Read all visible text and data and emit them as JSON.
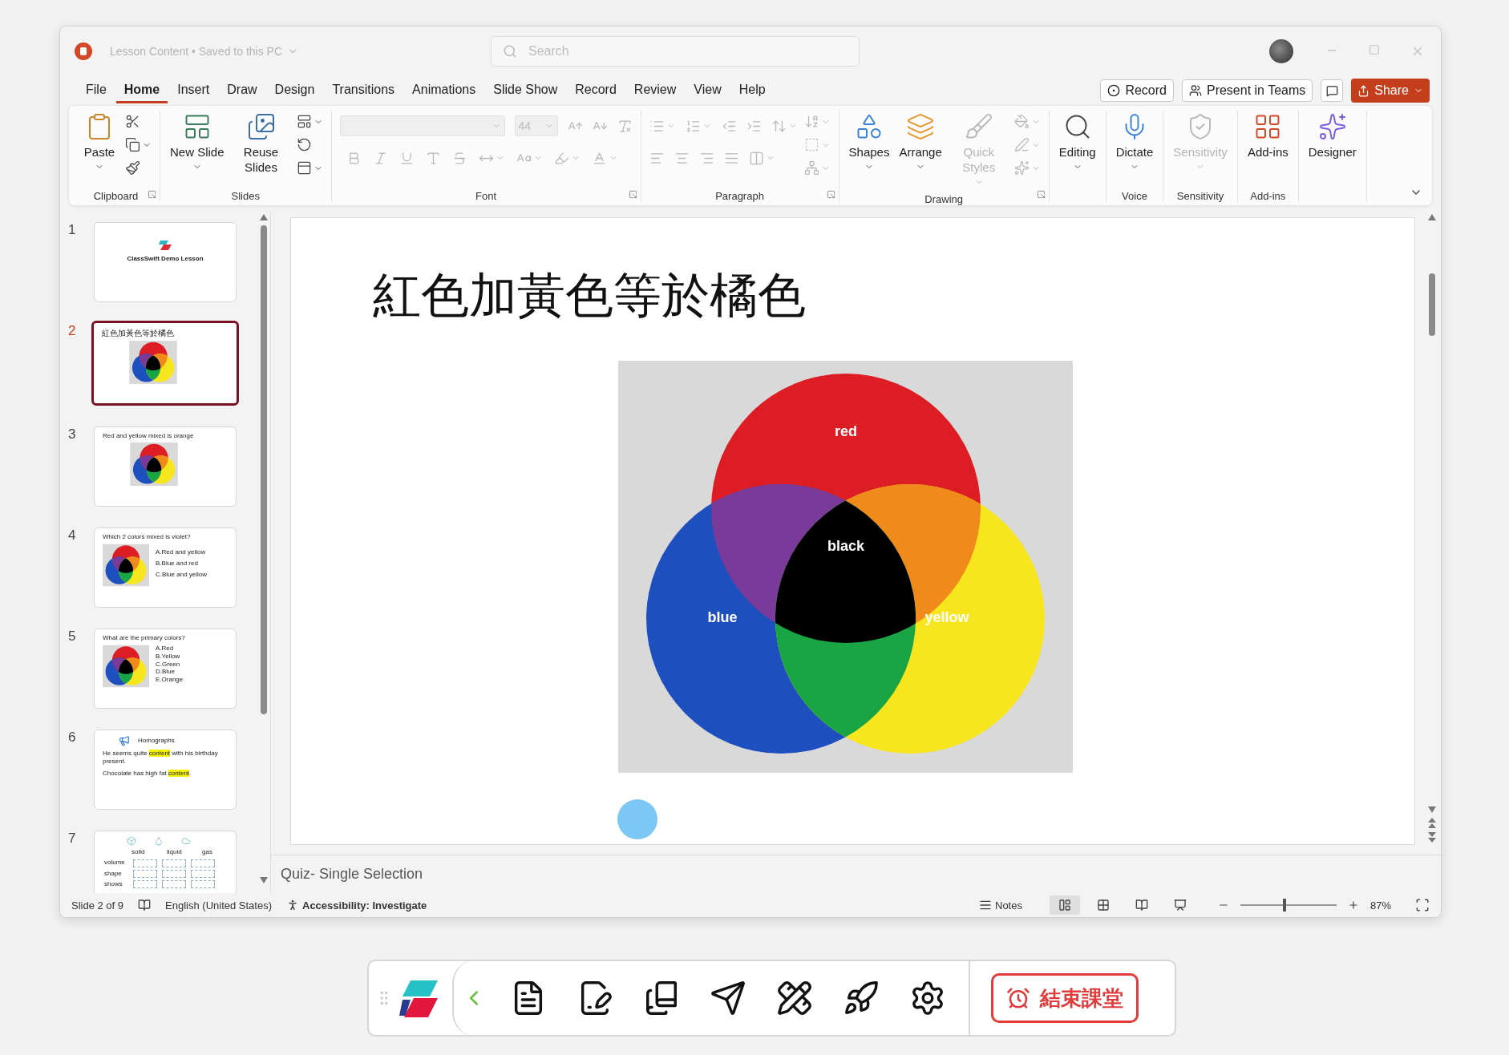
{
  "title_bar": {
    "document": "Lesson Content • Saved to this PC"
  },
  "search": {
    "placeholder": "Search"
  },
  "menu_tabs": [
    {
      "label": "File",
      "selected": false
    },
    {
      "label": "Home",
      "selected": true
    },
    {
      "label": "Insert",
      "selected": false
    },
    {
      "label": "Draw",
      "selected": false
    },
    {
      "label": "Design",
      "selected": false
    },
    {
      "label": "Transitions",
      "selected": false
    },
    {
      "label": "Animations",
      "selected": false
    },
    {
      "label": "Slide Show",
      "selected": false
    },
    {
      "label": "Record",
      "selected": false
    },
    {
      "label": "Review",
      "selected": false
    },
    {
      "label": "View",
      "selected": false
    },
    {
      "label": "Help",
      "selected": false
    }
  ],
  "header_buttons": {
    "record": "Record",
    "present": "Present in Teams",
    "share": "Share"
  },
  "ribbon": [
    {
      "kind": "clipboard",
      "label": "Clipboard",
      "launcher": true,
      "disabled": false,
      "buttons": [
        {
          "label": "Paste",
          "caret": true,
          "disabled": false
        }
      ]
    },
    {
      "kind": "slides",
      "label": "Slides",
      "launcher": false,
      "disabled": false,
      "buttons": [
        {
          "label": "New Slide",
          "caret": true,
          "disabled": false
        },
        {
          "label": "Reuse Slides",
          "caret": false,
          "disabled": false
        }
      ]
    },
    {
      "kind": "font",
      "label": "Font",
      "launcher": true,
      "disabled": true,
      "font_size": "44"
    },
    {
      "kind": "paragraph",
      "label": "Paragraph",
      "launcher": true,
      "disabled": true
    },
    {
      "kind": "drawing",
      "label": "Drawing",
      "launcher": true,
      "disabled": true,
      "buttons": [
        {
          "label": "Shapes",
          "caret": true,
          "disabled": false
        },
        {
          "label": "Arrange",
          "caret": true,
          "disabled": false
        },
        {
          "label": "Quick Styles",
          "caret": true,
          "disabled": true
        }
      ]
    },
    {
      "kind": "editing",
      "buttons": [
        {
          "label": "Editing",
          "caret": true,
          "disabled": false
        }
      ]
    },
    {
      "kind": "voice",
      "label": "Voice",
      "launcher": false,
      "buttons": [
        {
          "label": "Dictate",
          "caret": true,
          "disabled": false
        }
      ]
    },
    {
      "kind": "sensitivity",
      "label": "Sensitivity",
      "launcher": false,
      "buttons": [
        {
          "label": "Sensitivity",
          "caret": true,
          "disabled": true
        }
      ]
    },
    {
      "kind": "addins",
      "label": "Add-ins",
      "launcher": false,
      "buttons": [
        {
          "label": "Add-ins",
          "caret": false,
          "disabled": false
        }
      ]
    },
    {
      "kind": "designer",
      "buttons": [
        {
          "label": "Designer",
          "caret": false,
          "disabled": false
        }
      ]
    }
  ],
  "slides": [
    {
      "number": "1",
      "selected": false,
      "kind": "title",
      "title": "ClassSwift Demo Lesson"
    },
    {
      "number": "2",
      "selected": true,
      "title": "紅色加黃色等於橘色"
    },
    {
      "number": "3",
      "selected": false,
      "title": "Red and yellow mixed is orange"
    },
    {
      "number": "4",
      "selected": false,
      "kind": "quiz",
      "title": "Which 2 colors mixed is violet?",
      "options": [
        "A.Red and yellow",
        "B.Blue and red",
        "C.Blue and yellow"
      ]
    },
    {
      "number": "5",
      "selected": false,
      "kind": "quiz",
      "title": "What are the primary colors?",
      "options": [
        "A.Red",
        "B.Yellow",
        "C.Green",
        "D.Blue",
        "E.Orange"
      ]
    },
    {
      "number": "6",
      "selected": false,
      "kind": "text",
      "title": "Homographs",
      "sentences": [
        {
          "parts": [
            {
              "text": "He seems quite ",
              "highlight": false
            },
            {
              "text": "content",
              "highlight": true
            },
            {
              "text": " with his birthday present.",
              "highlight": false
            }
          ]
        },
        {
          "parts": [
            {
              "text": "Chocolate has high fat ",
              "highlight": false
            },
            {
              "text": "content",
              "highlight": true
            },
            {
              "text": ".",
              "highlight": false
            }
          ]
        }
      ]
    },
    {
      "number": "7",
      "selected": false,
      "kind": "table",
      "columns": [
        "solid",
        "liquid",
        "gas"
      ],
      "rows": [
        "volume",
        "shape",
        "shows"
      ]
    }
  ],
  "slide": {
    "title": "紅色加黃色等於橘色",
    "venn_labels": [
      "red",
      "black",
      "blue",
      "yellow"
    ]
  },
  "notes": "Quiz- Single Selection",
  "status_bar": {
    "slide": "Slide 2 of 9",
    "language": "English (United States)",
    "accessibility": "Accessibility: Investigate",
    "notes": "Notes",
    "zoom": "87%",
    "zoom_slider": {
      "level": 0.44
    },
    "views": [
      {
        "selected": true
      },
      {
        "selected": false
      },
      {
        "selected": false
      },
      {
        "selected": false
      }
    ]
  },
  "toolbar": {
    "end_button": "結束課堂"
  }
}
